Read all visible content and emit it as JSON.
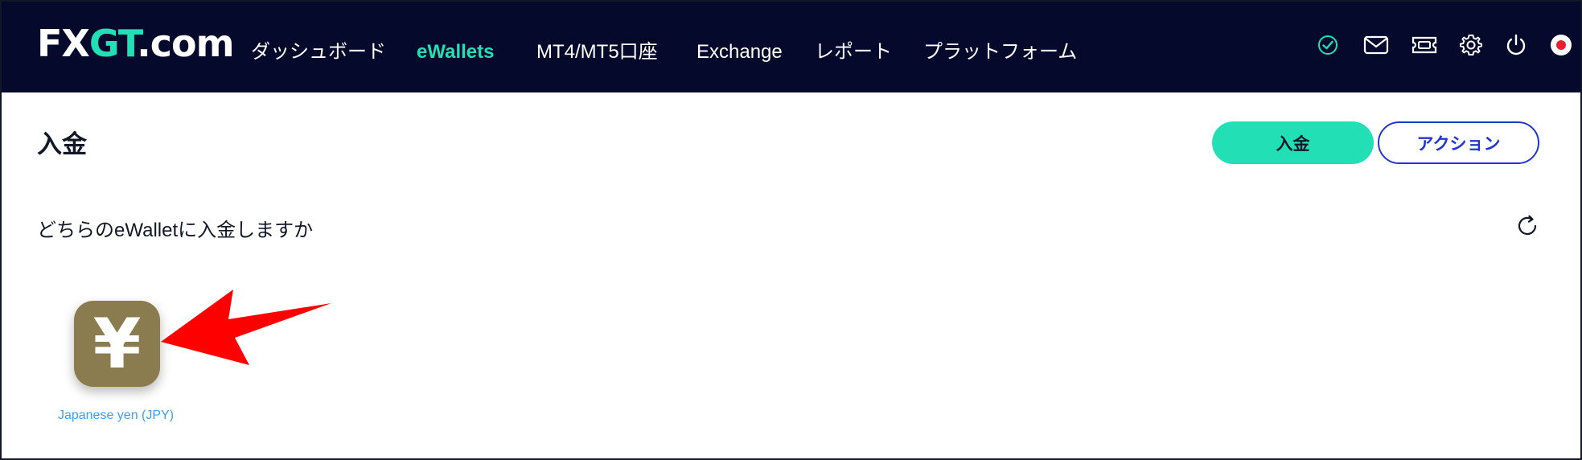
{
  "header": {
    "logo_text_a": "FX",
    "logo_text_b": "GT",
    "logo_text_c": ".com",
    "nav": [
      {
        "label": "ダッシュボード"
      },
      {
        "label": "eWallets"
      },
      {
        "label": "MT4/MT5口座"
      },
      {
        "label": "Exchange"
      },
      {
        "label": "レポート"
      },
      {
        "label": "プラットフォーム"
      }
    ],
    "icons": [
      "verified-check-icon",
      "mail-icon",
      "ticket-icon",
      "gear-icon",
      "power-icon",
      "japan-flag-icon"
    ]
  },
  "page": {
    "title": "入金",
    "deposit_button": "入金",
    "action_button": "アクション",
    "subtitle": "どちらのeWalletに入金しますか"
  },
  "wallets": [
    {
      "symbol": "¥",
      "label": "Japanese yen (JPY)"
    }
  ],
  "colors": {
    "header_bg": "#050a2c",
    "accent": "#22dfb6",
    "action_blue": "#2137c9",
    "wallet_tile": "#8b7c4f",
    "wallet_label": "#3b9ff2",
    "annotation_arrow": "#ff0000"
  }
}
